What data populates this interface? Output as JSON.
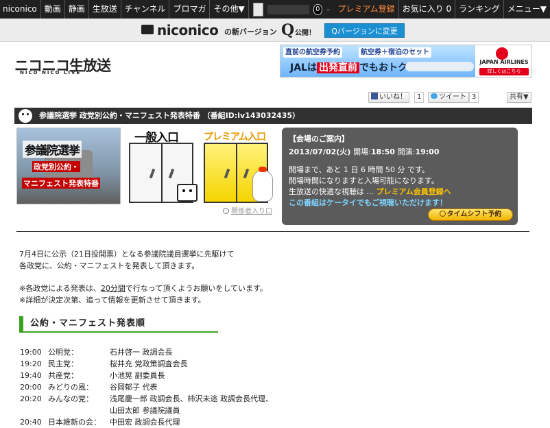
{
  "topnav": {
    "items": [
      "niconico",
      "動画",
      "静画",
      "生放送",
      "チャンネル",
      "ブロマガ",
      "その他▼"
    ],
    "points": "0",
    "separator": "–",
    "premium": "プレミアム登録",
    "favorites": "お気に入り 0",
    "ranking": "ランキング",
    "menu": "メニュー▼"
  },
  "qbar": {
    "logo": "niconico",
    "text1": "の新バージョン",
    "q": "Q",
    "text2": "公開！",
    "button": "Qバージョンに変更"
  },
  "site_logo": {
    "main": "ニコニコ生放送",
    "sub": "NICO NICO LIVE"
  },
  "ad": {
    "l1a": "直前の航空券予約",
    "l1b": "航空券＋宿泊のセット",
    "l2a": "JALは",
    "l2b": "出発直前",
    "l2c": "でもおトク!",
    "brand": "JAPAN AIRLINES",
    "cta": "詳しくはこちら"
  },
  "social": {
    "like": "いいね！",
    "like_count": "1",
    "tweet": "ツイート",
    "tweet_count": "3",
    "share": "共有▼"
  },
  "program": {
    "title": "参議院選挙 政党別公約・マニフェスト発表特番 （番組ID:lv143032435）",
    "thumb_w1": "参議院選挙",
    "thumb_w2": "政党別公約・",
    "thumb_w3": "マニフェスト発表特番",
    "gate_general": "一般入口",
    "gate_premium": "プレミアム入口",
    "related": "関係者入り口"
  },
  "info": {
    "header": "【会場のご案内】",
    "date": "2013/07/02(火)",
    "open_label": "開場:",
    "open_time": "18:50",
    "start_label": "開演:",
    "start_time": "19:00",
    "line1": "開場まで、あと 1 日 6 時間 50 分 です。",
    "line2": "開場時間になりますと入場可能になります。",
    "line3a": "生放送の快適な視聴は ... ",
    "line3b": "プレミアム会員登録へ",
    "line4": "この番組はケータイでもご視聴いただけます！",
    "timeshift": "タイムシフト予約"
  },
  "intro": {
    "p1a": "7月4日に公示（21日投開票）となる参議院議員選挙に先駆けて",
    "p1b": "各政党に、公約・マニフェストを発表して頂きます。",
    "p2a1": "※各政党による発表は、",
    "p2a2": "20分間",
    "p2a3": "で行なって頂くようお願いをしています。",
    "p2b": "※詳細が決定次第、追って情報を更新させて頂きます。"
  },
  "order_heading": "公約・マニフェスト発表順",
  "schedule": [
    {
      "time": "19:00",
      "party": "公明党：",
      "speaker": "石井啓一 政調会長"
    },
    {
      "time": "19:20",
      "party": "民主党：",
      "speaker": "桜井充 党政策調査会長"
    },
    {
      "time": "19:40",
      "party": "共産党：",
      "speaker": "小池晃 副委員長"
    },
    {
      "time": "20:00",
      "party": "みどりの風：",
      "speaker": "谷岡郁子 代表"
    },
    {
      "time": "20:20",
      "party": "みんなの党：",
      "speaker": "浅尾慶一郎 政調会長、柿沢未途 政調会長代理、"
    },
    {
      "time": "",
      "party": "",
      "speaker": "山田太郎 参議院議員"
    },
    {
      "time": "20:40",
      "party": "日本維新の会：",
      "speaker": "中田宏 政調会長代理"
    }
  ]
}
